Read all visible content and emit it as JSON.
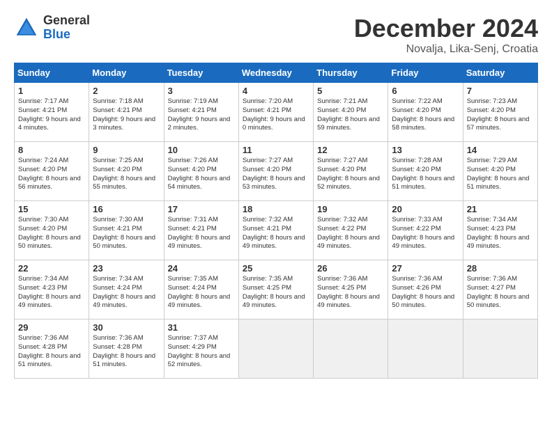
{
  "header": {
    "logo_general": "General",
    "logo_blue": "Blue",
    "title": "December 2024",
    "subtitle": "Novalja, Lika-Senj, Croatia"
  },
  "weekdays": [
    "Sunday",
    "Monday",
    "Tuesday",
    "Wednesday",
    "Thursday",
    "Friday",
    "Saturday"
  ],
  "weeks": [
    [
      {
        "day": "1",
        "sunrise": "7:17 AM",
        "sunset": "4:21 PM",
        "daylight": "9 hours and 4 minutes."
      },
      {
        "day": "2",
        "sunrise": "7:18 AM",
        "sunset": "4:21 PM",
        "daylight": "9 hours and 3 minutes."
      },
      {
        "day": "3",
        "sunrise": "7:19 AM",
        "sunset": "4:21 PM",
        "daylight": "9 hours and 2 minutes."
      },
      {
        "day": "4",
        "sunrise": "7:20 AM",
        "sunset": "4:21 PM",
        "daylight": "9 hours and 0 minutes."
      },
      {
        "day": "5",
        "sunrise": "7:21 AM",
        "sunset": "4:20 PM",
        "daylight": "8 hours and 59 minutes."
      },
      {
        "day": "6",
        "sunrise": "7:22 AM",
        "sunset": "4:20 PM",
        "daylight": "8 hours and 58 minutes."
      },
      {
        "day": "7",
        "sunrise": "7:23 AM",
        "sunset": "4:20 PM",
        "daylight": "8 hours and 57 minutes."
      }
    ],
    [
      {
        "day": "8",
        "sunrise": "7:24 AM",
        "sunset": "4:20 PM",
        "daylight": "8 hours and 56 minutes."
      },
      {
        "day": "9",
        "sunrise": "7:25 AM",
        "sunset": "4:20 PM",
        "daylight": "8 hours and 55 minutes."
      },
      {
        "day": "10",
        "sunrise": "7:26 AM",
        "sunset": "4:20 PM",
        "daylight": "8 hours and 54 minutes."
      },
      {
        "day": "11",
        "sunrise": "7:27 AM",
        "sunset": "4:20 PM",
        "daylight": "8 hours and 53 minutes."
      },
      {
        "day": "12",
        "sunrise": "7:27 AM",
        "sunset": "4:20 PM",
        "daylight": "8 hours and 52 minutes."
      },
      {
        "day": "13",
        "sunrise": "7:28 AM",
        "sunset": "4:20 PM",
        "daylight": "8 hours and 51 minutes."
      },
      {
        "day": "14",
        "sunrise": "7:29 AM",
        "sunset": "4:20 PM",
        "daylight": "8 hours and 51 minutes."
      }
    ],
    [
      {
        "day": "15",
        "sunrise": "7:30 AM",
        "sunset": "4:20 PM",
        "daylight": "8 hours and 50 minutes."
      },
      {
        "day": "16",
        "sunrise": "7:30 AM",
        "sunset": "4:21 PM",
        "daylight": "8 hours and 50 minutes."
      },
      {
        "day": "17",
        "sunrise": "7:31 AM",
        "sunset": "4:21 PM",
        "daylight": "8 hours and 49 minutes."
      },
      {
        "day": "18",
        "sunrise": "7:32 AM",
        "sunset": "4:21 PM",
        "daylight": "8 hours and 49 minutes."
      },
      {
        "day": "19",
        "sunrise": "7:32 AM",
        "sunset": "4:22 PM",
        "daylight": "8 hours and 49 minutes."
      },
      {
        "day": "20",
        "sunrise": "7:33 AM",
        "sunset": "4:22 PM",
        "daylight": "8 hours and 49 minutes."
      },
      {
        "day": "21",
        "sunrise": "7:34 AM",
        "sunset": "4:23 PM",
        "daylight": "8 hours and 49 minutes."
      }
    ],
    [
      {
        "day": "22",
        "sunrise": "7:34 AM",
        "sunset": "4:23 PM",
        "daylight": "8 hours and 49 minutes."
      },
      {
        "day": "23",
        "sunrise": "7:34 AM",
        "sunset": "4:24 PM",
        "daylight": "8 hours and 49 minutes."
      },
      {
        "day": "24",
        "sunrise": "7:35 AM",
        "sunset": "4:24 PM",
        "daylight": "8 hours and 49 minutes."
      },
      {
        "day": "25",
        "sunrise": "7:35 AM",
        "sunset": "4:25 PM",
        "daylight": "8 hours and 49 minutes."
      },
      {
        "day": "26",
        "sunrise": "7:36 AM",
        "sunset": "4:25 PM",
        "daylight": "8 hours and 49 minutes."
      },
      {
        "day": "27",
        "sunrise": "7:36 AM",
        "sunset": "4:26 PM",
        "daylight": "8 hours and 50 minutes."
      },
      {
        "day": "28",
        "sunrise": "7:36 AM",
        "sunset": "4:27 PM",
        "daylight": "8 hours and 50 minutes."
      }
    ],
    [
      {
        "day": "29",
        "sunrise": "7:36 AM",
        "sunset": "4:28 PM",
        "daylight": "8 hours and 51 minutes."
      },
      {
        "day": "30",
        "sunrise": "7:36 AM",
        "sunset": "4:28 PM",
        "daylight": "8 hours and 51 minutes."
      },
      {
        "day": "31",
        "sunrise": "7:37 AM",
        "sunset": "4:29 PM",
        "daylight": "8 hours and 52 minutes."
      },
      null,
      null,
      null,
      null
    ]
  ],
  "labels": {
    "sunrise": "Sunrise:",
    "sunset": "Sunset:",
    "daylight": "Daylight:"
  }
}
